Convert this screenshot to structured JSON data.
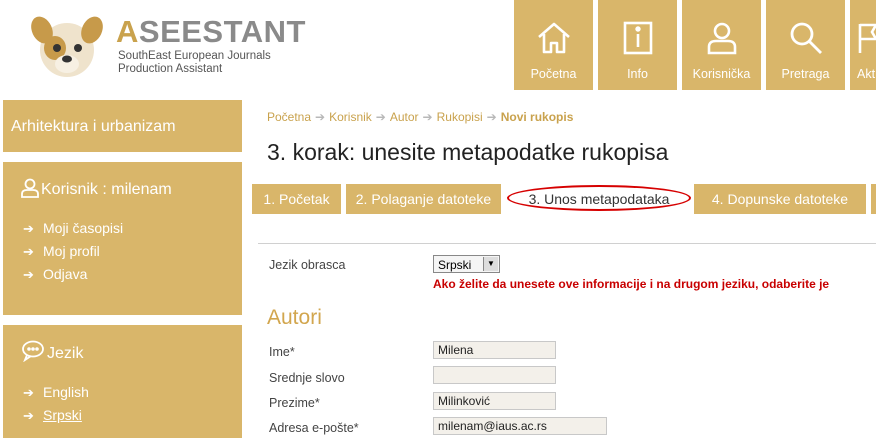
{
  "header": {
    "brand_prefix": "A",
    "brand_rest": "SEESTANT",
    "subtitle_line1": "SouthEast European Journals",
    "subtitle_line2": "Production Assistant",
    "nav": [
      {
        "label": "Početna",
        "icon": "home-icon"
      },
      {
        "label": "Info",
        "icon": "info-icon"
      },
      {
        "label": "Korisnička",
        "icon": "user-icon"
      },
      {
        "label": "Pretraga",
        "icon": "search-icon"
      },
      {
        "label": "Akt",
        "icon": "flag-icon"
      }
    ]
  },
  "sidebar": {
    "journal": "Arhitektura i urbanizam",
    "user_title": "Korisnik : milenam",
    "user_links": [
      "Moji časopisi",
      "Moj profil",
      "Odjava"
    ],
    "lang_title": "Jezik",
    "lang_links": [
      "English",
      "Srpski"
    ]
  },
  "breadcrumb": {
    "items": [
      "Početna",
      "Korisnik",
      "Autor",
      "Rukopisi"
    ],
    "current": "Novi rukopis"
  },
  "page_title": "3. korak: unesite metapodatke rukopisa",
  "steps": [
    {
      "label": "1. Početak"
    },
    {
      "label": "2. Polaganje datoteke"
    },
    {
      "label": "3. Unos metapodataka",
      "active": true
    },
    {
      "label": "4. Dopunske datoteke"
    }
  ],
  "form": {
    "language_label": "Jezik obrasca",
    "language_value": "Srpski",
    "language_warning": "Ako želite da unesete ove informacije i na drugom jeziku, odaberite je",
    "authors_heading": "Autori",
    "fields": [
      {
        "label": "Ime*",
        "value": "Milena"
      },
      {
        "label": "Srednje slovo",
        "value": ""
      },
      {
        "label": "Prezime*",
        "value": "Milinković"
      },
      {
        "label": "Adresa e-pošte*",
        "value": "milenam@iaus.ac.rs"
      }
    ]
  },
  "colors": {
    "accent": "#d9b66a",
    "warning": "#c80000",
    "highlight": "#d60000"
  }
}
